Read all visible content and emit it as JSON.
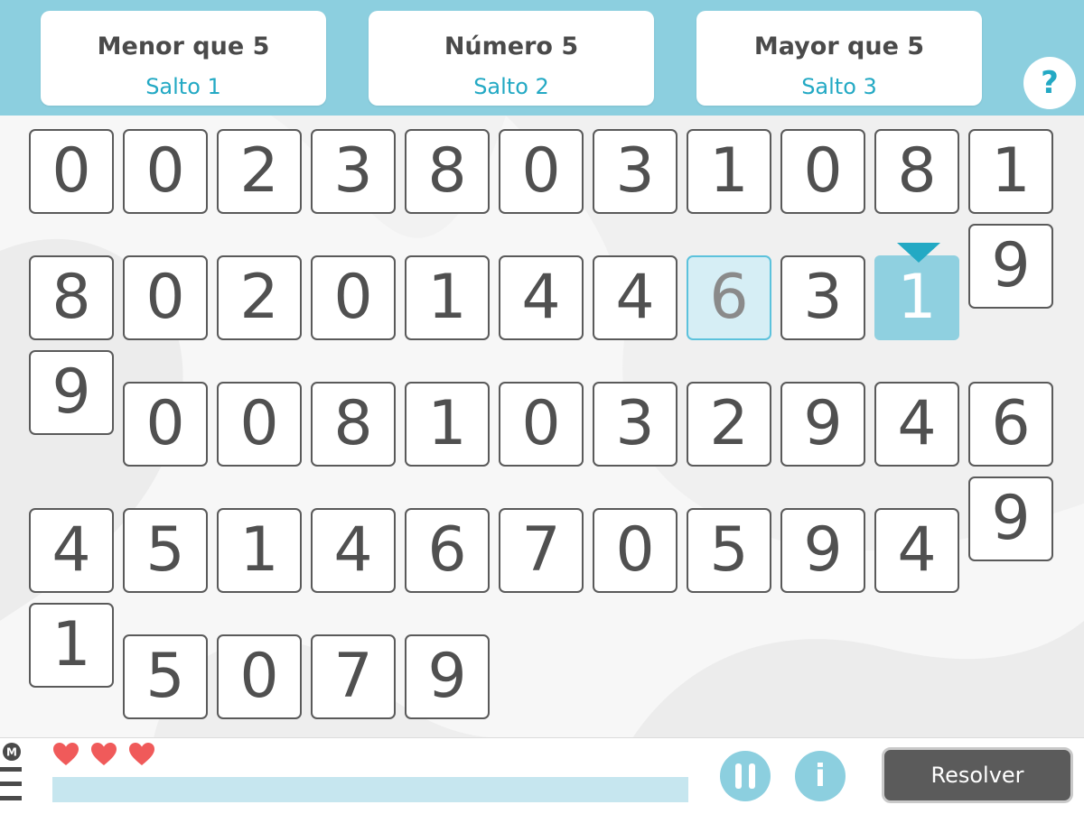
{
  "rules": [
    {
      "title": "Menor que 5",
      "subtitle": "Salto 1"
    },
    {
      "title": "Número 5",
      "subtitle": "Salto 2"
    },
    {
      "title": "Mayor que 5",
      "subtitle": "Salto 3"
    }
  ],
  "help_label": "?",
  "board": {
    "tiles": [
      {
        "value": "0",
        "state": "normal"
      },
      {
        "value": "0",
        "state": "normal"
      },
      {
        "value": "2",
        "state": "normal"
      },
      {
        "value": "3",
        "state": "normal"
      },
      {
        "value": "8",
        "state": "normal"
      },
      {
        "value": "0",
        "state": "normal"
      },
      {
        "value": "3",
        "state": "normal"
      },
      {
        "value": "1",
        "state": "normal"
      },
      {
        "value": "0",
        "state": "normal"
      },
      {
        "value": "8",
        "state": "normal"
      },
      {
        "value": "1",
        "state": "normal"
      },
      {
        "value": "8",
        "state": "normal"
      },
      {
        "value": "0",
        "state": "normal"
      },
      {
        "value": "2",
        "state": "normal"
      },
      {
        "value": "0",
        "state": "normal"
      },
      {
        "value": "1",
        "state": "normal"
      },
      {
        "value": "4",
        "state": "normal"
      },
      {
        "value": "4",
        "state": "normal"
      },
      {
        "value": "6",
        "state": "hint"
      },
      {
        "value": "3",
        "state": "normal"
      },
      {
        "value": "1",
        "state": "current"
      },
      {
        "value": "9",
        "state": "normal"
      },
      {
        "value": "9",
        "state": "normal"
      },
      {
        "value": "0",
        "state": "normal"
      },
      {
        "value": "0",
        "state": "normal"
      },
      {
        "value": "8",
        "state": "normal"
      },
      {
        "value": "1",
        "state": "normal"
      },
      {
        "value": "0",
        "state": "normal"
      },
      {
        "value": "3",
        "state": "normal"
      },
      {
        "value": "2",
        "state": "normal"
      },
      {
        "value": "9",
        "state": "normal"
      },
      {
        "value": "4",
        "state": "normal"
      },
      {
        "value": "6",
        "state": "normal"
      },
      {
        "value": "9",
        "state": "normal"
      },
      {
        "value": "4",
        "state": "normal"
      },
      {
        "value": "5",
        "state": "normal"
      },
      {
        "value": "1",
        "state": "normal"
      },
      {
        "value": "4",
        "state": "normal"
      },
      {
        "value": "6",
        "state": "normal"
      },
      {
        "value": "7",
        "state": "normal"
      },
      {
        "value": "0",
        "state": "normal"
      },
      {
        "value": "5",
        "state": "normal"
      },
      {
        "value": "9",
        "state": "normal"
      },
      {
        "value": "4",
        "state": "normal"
      },
      {
        "value": "1",
        "state": "normal"
      },
      {
        "value": "5",
        "state": "normal"
      },
      {
        "value": "0",
        "state": "normal"
      },
      {
        "value": "7",
        "state": "normal"
      },
      {
        "value": "9",
        "state": "normal"
      }
    ]
  },
  "footer": {
    "menu_badge": "M",
    "lives": 3,
    "progress": 0,
    "pause_icon": "pause-icon",
    "info_label": "i",
    "resolve_label": "Resolver"
  },
  "colors": {
    "header": "#8ccfdf",
    "accent": "#23a9c4",
    "heart": "#f05a5a",
    "resolve_button": "#5b5b5b"
  }
}
